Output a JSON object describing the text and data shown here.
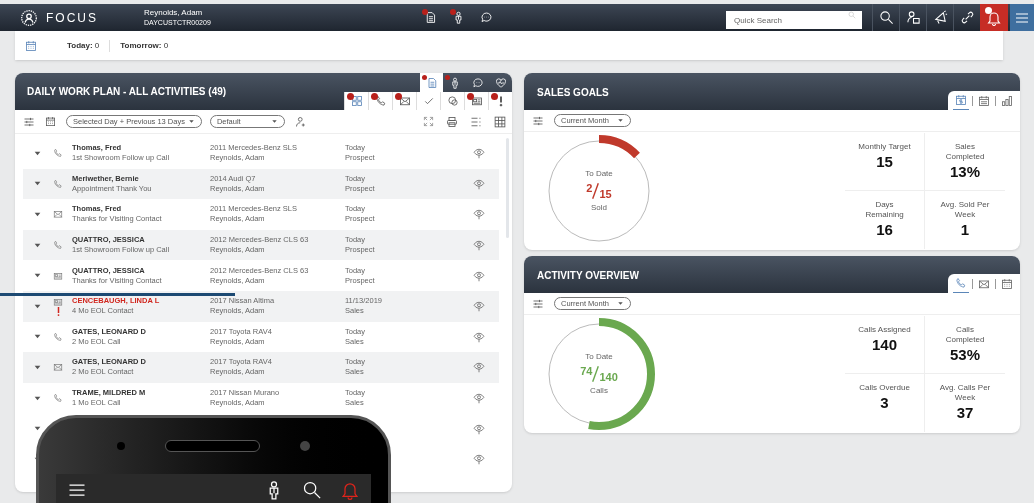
{
  "top_bar": {
    "app_name": "FOCUS",
    "user_name": "Reynolds, Adam",
    "user_id": "DAYCUSTCTR00209",
    "center_icons": [
      {
        "kind": "document",
        "badge": true
      },
      {
        "kind": "person",
        "badge": true
      },
      {
        "kind": "chat",
        "badge": false
      }
    ],
    "search": {
      "placeholder": "Quick Search"
    },
    "right_icons": [
      {
        "kind": "search"
      },
      {
        "kind": "userbox"
      },
      {
        "kind": "megaphone"
      },
      {
        "kind": "link"
      }
    ],
    "alerts": {
      "badge": true
    }
  },
  "summary_bar": {
    "items": [
      "**Today:** 0",
      "**Tomorrow:** 0"
    ]
  },
  "work_plan": {
    "title": "DAILY WORK PLAN - ALL ACTIVITIES (49)",
    "tabs": [
      {
        "kind": "document",
        "selected": true,
        "badge": true
      },
      {
        "kind": "person",
        "selected": false,
        "badge": true
      },
      {
        "kind": "chat",
        "selected": false,
        "badge": false
      },
      {
        "kind": "heart",
        "selected": false,
        "badge": false
      }
    ],
    "filters": [
      {
        "kind": "grid4",
        "badge": true
      },
      {
        "kind": "phone",
        "badge": true
      },
      {
        "kind": "mail",
        "badge": true
      },
      {
        "kind": "check",
        "badge": false
      },
      {
        "kind": "chatcircles",
        "badge": false
      },
      {
        "kind": "card",
        "badge": true
      },
      {
        "kind": "exclaim",
        "badge": true
      }
    ],
    "period": "Selected Day + Previous 13 Days",
    "view": "Default",
    "rows": [
      {
        "kind": "phone",
        "name": "Thomas, Fred",
        "task": "1st Showroom Follow up Call",
        "vehicle": "2011 Mercedes-Benz SLS",
        "owner": "Reynolds, Adam",
        "date": "Today",
        "stage": "Prospect",
        "alert": false
      },
      {
        "kind": "phone",
        "name": "Meriwether, Bernie",
        "task": "Appointment Thank You",
        "vehicle": "2014 Audi Q7",
        "owner": "Reynolds, Adam",
        "date": "Today",
        "stage": "Prospect",
        "alert": false
      },
      {
        "kind": "mail",
        "name": "Thomas, Fred",
        "task": "Thanks for Visiting Contact",
        "vehicle": "2011 Mercedes-Benz SLS",
        "owner": "Reynolds, Adam",
        "date": "Today",
        "stage": "Prospect",
        "alert": false
      },
      {
        "kind": "phone",
        "name": "QUATTRO, JESSICA",
        "task": "1st Showroom Follow up Call",
        "vehicle": "2012 Mercedes-Benz CLS 63",
        "owner": "Reynolds, Adam",
        "date": "Today",
        "stage": "Prospect",
        "alert": false
      },
      {
        "kind": "card",
        "name": "QUATTRO, JESSICA",
        "task": "Thanks for Visiting Contact",
        "vehicle": "2012 Mercedes-Benz CLS 63",
        "owner": "Reynolds, Adam",
        "date": "Today",
        "stage": "Prospect",
        "alert": false
      },
      {
        "kind": "card",
        "name": "CENCEBAUGH, LINDA L",
        "task": "4 Mo EOL Contact",
        "vehicle": "2017 Nissan Altima",
        "owner": "Reynolds, Adam",
        "date": "11/13/2019",
        "stage": "Sales",
        "alert": true
      },
      {
        "kind": "phone",
        "name": "GATES, LEONARD D",
        "task": "2 Mo EOL Call",
        "vehicle": "2017 Toyota RAV4",
        "owner": "Reynolds, Adam",
        "date": "Today",
        "stage": "Sales",
        "alert": false
      },
      {
        "kind": "mail",
        "name": "GATES, LEONARD D",
        "task": "2 Mo EOL Contact",
        "vehicle": "2017 Toyota RAV4",
        "owner": "Reynolds, Adam",
        "date": "Today",
        "stage": "Sales",
        "alert": false
      },
      {
        "kind": "phone",
        "name": "TRAME, MILDRED M",
        "task": "1 Mo EOL Call",
        "vehicle": "2017 Nissan Murano",
        "owner": "Reynolds, Adam",
        "date": "Today",
        "stage": "Sales",
        "alert": false
      },
      {
        "kind": "covered"
      },
      {
        "kind": "covered"
      }
    ]
  },
  "sales_goals": {
    "title": "SALES GOALS",
    "tabs": [
      {
        "kind": "caldollar",
        "selected": true
      },
      {
        "kind": "cal2w",
        "selected": false
      },
      {
        "kind": "bars",
        "selected": false
      }
    ],
    "period": "Current Month",
    "gauge": {
      "label": "To Date",
      "count": "2",
      "total": "15",
      "unit": "Sold",
      "level": 0.13,
      "color": "#c0392b"
    },
    "stats": [
      {
        "label": "Monthly Target",
        "value": "15"
      },
      {
        "label": "Sales Completed",
        "value": "13%"
      },
      {
        "label": "Days Remaining",
        "value": "16"
      },
      {
        "label": "Avg. Sold Per Week",
        "value": "1"
      }
    ]
  },
  "activity_overview": {
    "title": "ACTIVITY OVERVIEW",
    "tabs": [
      {
        "kind": "phone",
        "selected": true
      },
      {
        "kind": "mail",
        "selected": false
      },
      {
        "kind": "calendar",
        "selected": false
      }
    ],
    "period": "Current Month",
    "gauge": {
      "label": "To Date",
      "count": "74",
      "total": "140",
      "unit": "Calls",
      "level": 0.53,
      "color": "#6aa84f"
    },
    "stats": [
      {
        "label": "Calls Assigned",
        "value": "140"
      },
      {
        "label": "Calls Completed",
        "value": "53%"
      },
      {
        "label": "Calls Overdue",
        "value": "3"
      },
      {
        "label": "Avg. Calls Per Week",
        "value": "37"
      }
    ]
  },
  "phone_overlay": {
    "icons": [
      {
        "kind": "menu"
      },
      {
        "kind": "person"
      },
      {
        "kind": "search"
      },
      {
        "kind": "bell"
      }
    ]
  }
}
